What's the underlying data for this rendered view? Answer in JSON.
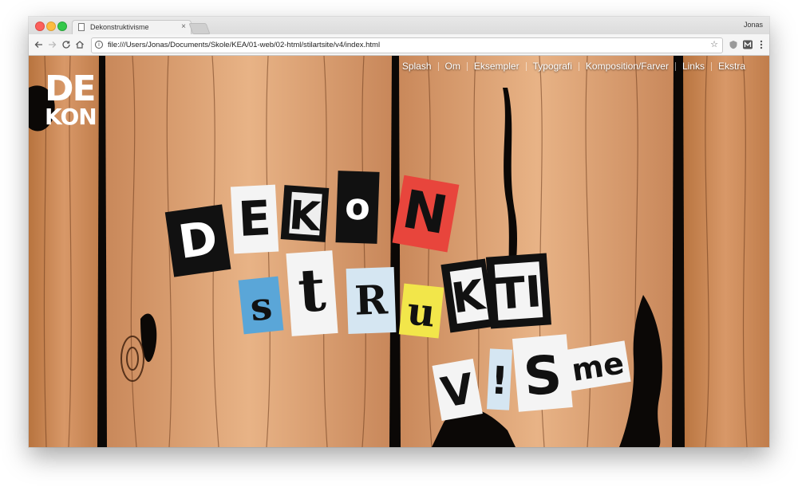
{
  "browser": {
    "tab_title": "Dekonstruktivisme",
    "tab_close": "×",
    "user_name": "Jonas",
    "url": "file:///Users/Jonas/Documents/Skole/KEA/01-web/02-html/stilartsite/v4/index.html",
    "star_icon": "star-icon"
  },
  "nav": {
    "items": [
      "Splash",
      "Om",
      "Eksempler",
      "Typografi",
      "Komposition/Farver",
      "Links",
      "Ekstra"
    ]
  },
  "logo": {
    "line1": "DE",
    "line2": "KON"
  },
  "hero": {
    "title_line1": [
      "D",
      "E",
      "K",
      "o",
      "N"
    ],
    "title_line2": [
      "s",
      "t",
      "R",
      "u",
      "K",
      "TI"
    ],
    "title_line3": [
      "V",
      "!",
      "S",
      "me"
    ],
    "colors": {
      "wood": "#c98a5a",
      "red": "#e8453c",
      "blue": "#5aa6d8",
      "yellow": "#f2e64a"
    }
  }
}
